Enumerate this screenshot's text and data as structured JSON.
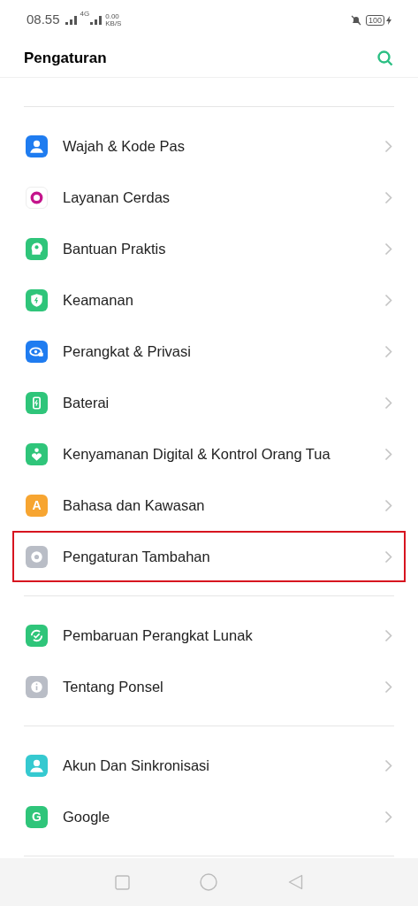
{
  "status_bar": {
    "time": "08.55",
    "network_type": "4G",
    "speed_value": "0.00",
    "speed_unit": "KB/S",
    "battery": "100"
  },
  "header": {
    "title": "Pengaturan"
  },
  "groups": [
    {
      "items": [
        {
          "label": "Wajah & Kode Pas",
          "kind": "face",
          "color": "#1f7cf0",
          "highlighted": false
        },
        {
          "label": "Layanan Cerdas",
          "kind": "ring",
          "color": "#ffffff",
          "highlighted": false
        },
        {
          "label": "Bantuan Praktis",
          "kind": "head",
          "color": "#2fc57a",
          "highlighted": false
        },
        {
          "label": "Keamanan",
          "kind": "shield",
          "color": "#2fc57a",
          "highlighted": false
        },
        {
          "label": "Perangkat & Privasi",
          "kind": "eye",
          "color": "#1f7cf0",
          "highlighted": false
        },
        {
          "label": "Baterai",
          "kind": "battery",
          "color": "#2fc57a",
          "highlighted": false
        },
        {
          "label": "Kenyamanan Digital & Kontrol Orang Tua",
          "kind": "heart",
          "color": "#2fc57a",
          "highlighted": false
        },
        {
          "label": "Bahasa dan Kawasan",
          "kind": "letter",
          "letter": "A",
          "color": "#f7a531",
          "highlighted": false
        },
        {
          "label": "Pengaturan Tambahan",
          "kind": "dot",
          "color": "#b9bdc6",
          "highlighted": true
        }
      ]
    },
    {
      "items": [
        {
          "label": "Pembaruan Perangkat Lunak",
          "kind": "sync",
          "color": "#2fc57a",
          "highlighted": false
        },
        {
          "label": "Tentang Ponsel",
          "kind": "info",
          "color": "#b9bdc6",
          "highlighted": false
        }
      ]
    },
    {
      "items": [
        {
          "label": "Akun Dan Sinkronisasi",
          "kind": "person",
          "color": "#35c9d0",
          "highlighted": false
        },
        {
          "label": "Google",
          "kind": "letter",
          "letter": "G",
          "color": "#2fc57a",
          "highlighted": false
        }
      ]
    }
  ]
}
